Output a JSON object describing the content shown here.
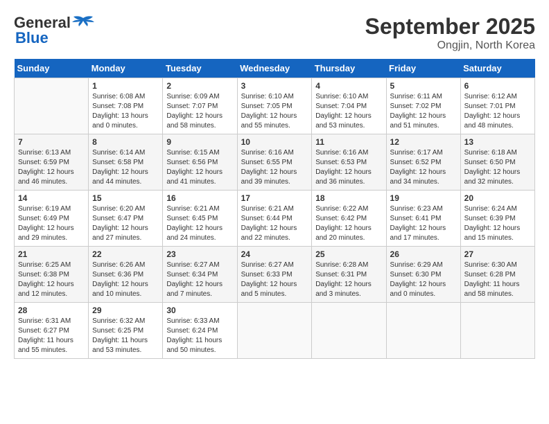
{
  "header": {
    "logo_line1": "General",
    "logo_line2": "Blue",
    "month": "September 2025",
    "location": "Ongjin, North Korea"
  },
  "days_of_week": [
    "Sunday",
    "Monday",
    "Tuesday",
    "Wednesday",
    "Thursday",
    "Friday",
    "Saturday"
  ],
  "weeks": [
    [
      {
        "day": "",
        "info": ""
      },
      {
        "day": "1",
        "info": "Sunrise: 6:08 AM\nSunset: 7:08 PM\nDaylight: 13 hours\nand 0 minutes."
      },
      {
        "day": "2",
        "info": "Sunrise: 6:09 AM\nSunset: 7:07 PM\nDaylight: 12 hours\nand 58 minutes."
      },
      {
        "day": "3",
        "info": "Sunrise: 6:10 AM\nSunset: 7:05 PM\nDaylight: 12 hours\nand 55 minutes."
      },
      {
        "day": "4",
        "info": "Sunrise: 6:10 AM\nSunset: 7:04 PM\nDaylight: 12 hours\nand 53 minutes."
      },
      {
        "day": "5",
        "info": "Sunrise: 6:11 AM\nSunset: 7:02 PM\nDaylight: 12 hours\nand 51 minutes."
      },
      {
        "day": "6",
        "info": "Sunrise: 6:12 AM\nSunset: 7:01 PM\nDaylight: 12 hours\nand 48 minutes."
      }
    ],
    [
      {
        "day": "7",
        "info": "Sunrise: 6:13 AM\nSunset: 6:59 PM\nDaylight: 12 hours\nand 46 minutes."
      },
      {
        "day": "8",
        "info": "Sunrise: 6:14 AM\nSunset: 6:58 PM\nDaylight: 12 hours\nand 44 minutes."
      },
      {
        "day": "9",
        "info": "Sunrise: 6:15 AM\nSunset: 6:56 PM\nDaylight: 12 hours\nand 41 minutes."
      },
      {
        "day": "10",
        "info": "Sunrise: 6:16 AM\nSunset: 6:55 PM\nDaylight: 12 hours\nand 39 minutes."
      },
      {
        "day": "11",
        "info": "Sunrise: 6:16 AM\nSunset: 6:53 PM\nDaylight: 12 hours\nand 36 minutes."
      },
      {
        "day": "12",
        "info": "Sunrise: 6:17 AM\nSunset: 6:52 PM\nDaylight: 12 hours\nand 34 minutes."
      },
      {
        "day": "13",
        "info": "Sunrise: 6:18 AM\nSunset: 6:50 PM\nDaylight: 12 hours\nand 32 minutes."
      }
    ],
    [
      {
        "day": "14",
        "info": "Sunrise: 6:19 AM\nSunset: 6:49 PM\nDaylight: 12 hours\nand 29 minutes."
      },
      {
        "day": "15",
        "info": "Sunrise: 6:20 AM\nSunset: 6:47 PM\nDaylight: 12 hours\nand 27 minutes."
      },
      {
        "day": "16",
        "info": "Sunrise: 6:21 AM\nSunset: 6:45 PM\nDaylight: 12 hours\nand 24 minutes."
      },
      {
        "day": "17",
        "info": "Sunrise: 6:21 AM\nSunset: 6:44 PM\nDaylight: 12 hours\nand 22 minutes."
      },
      {
        "day": "18",
        "info": "Sunrise: 6:22 AM\nSunset: 6:42 PM\nDaylight: 12 hours\nand 20 minutes."
      },
      {
        "day": "19",
        "info": "Sunrise: 6:23 AM\nSunset: 6:41 PM\nDaylight: 12 hours\nand 17 minutes."
      },
      {
        "day": "20",
        "info": "Sunrise: 6:24 AM\nSunset: 6:39 PM\nDaylight: 12 hours\nand 15 minutes."
      }
    ],
    [
      {
        "day": "21",
        "info": "Sunrise: 6:25 AM\nSunset: 6:38 PM\nDaylight: 12 hours\nand 12 minutes."
      },
      {
        "day": "22",
        "info": "Sunrise: 6:26 AM\nSunset: 6:36 PM\nDaylight: 12 hours\nand 10 minutes."
      },
      {
        "day": "23",
        "info": "Sunrise: 6:27 AM\nSunset: 6:34 PM\nDaylight: 12 hours\nand 7 minutes."
      },
      {
        "day": "24",
        "info": "Sunrise: 6:27 AM\nSunset: 6:33 PM\nDaylight: 12 hours\nand 5 minutes."
      },
      {
        "day": "25",
        "info": "Sunrise: 6:28 AM\nSunset: 6:31 PM\nDaylight: 12 hours\nand 3 minutes."
      },
      {
        "day": "26",
        "info": "Sunrise: 6:29 AM\nSunset: 6:30 PM\nDaylight: 12 hours\nand 0 minutes."
      },
      {
        "day": "27",
        "info": "Sunrise: 6:30 AM\nSunset: 6:28 PM\nDaylight: 11 hours\nand 58 minutes."
      }
    ],
    [
      {
        "day": "28",
        "info": "Sunrise: 6:31 AM\nSunset: 6:27 PM\nDaylight: 11 hours\nand 55 minutes."
      },
      {
        "day": "29",
        "info": "Sunrise: 6:32 AM\nSunset: 6:25 PM\nDaylight: 11 hours\nand 53 minutes."
      },
      {
        "day": "30",
        "info": "Sunrise: 6:33 AM\nSunset: 6:24 PM\nDaylight: 11 hours\nand 50 minutes."
      },
      {
        "day": "",
        "info": ""
      },
      {
        "day": "",
        "info": ""
      },
      {
        "day": "",
        "info": ""
      },
      {
        "day": "",
        "info": ""
      }
    ]
  ]
}
